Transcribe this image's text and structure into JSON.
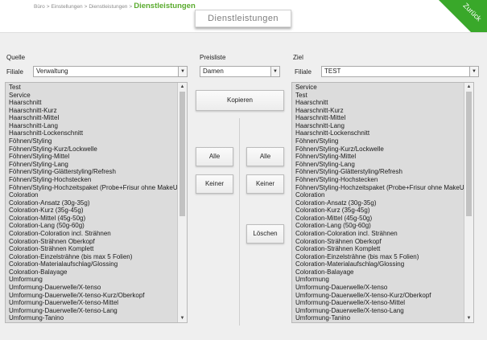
{
  "breadcrumb": {
    "items": [
      "Büro",
      "Einstellungen",
      "Dienstleistungen"
    ],
    "current": "Dienstleistungen",
    "separator": ">"
  },
  "header": {
    "title": "Dienstleistungen",
    "back_label": "Zurück",
    "accent_color": "#39a82a"
  },
  "source": {
    "section_label": "Quelle",
    "branch_label": "Filiale",
    "branch_value": "Verwaltung",
    "items": [
      "Test",
      "Service",
      "Haarschnitt",
      "Haarschnitt-Kurz",
      "Haarschnitt-Mittel",
      "Haarschnitt-Lang",
      "Haarschnitt-Lockenschnitt",
      "Föhnen/Styling",
      "Föhnen/Styling-Kurz/Lockwelle",
      "Föhnen/Styling-Mittel",
      "Föhnen/Styling-Lang",
      "Föhnen/Styling-Glätterstyling/Refresh",
      "Föhnen/Styling-Hochstecken",
      "Föhnen/Styling-Hochzeitspaket (Probe+Frisur ohne MakeUp)",
      "Coloration",
      "Coloration-Ansatz (30g-35g)",
      "Coloration-Kurz (35g-45g)",
      "Coloration-Mittel (45g-50g)",
      "Coloration-Lang (50g-60g)",
      "Coloration-Coloration incl. Strähnen",
      "Coloration-Strähnen Oberkopf",
      "Coloration-Strähnen Komplett",
      "Coloration-Einzelsträhne (bis max 5 Folien)",
      "Coloration-Materialaufschlag/Glossing",
      "Coloration-Balayage",
      "Umformung",
      "Umformung-Dauerwelle/X-tenso",
      "Umformung-Dauerwelle/X-tenso-Kurz/Oberkopf",
      "Umformung-Dauerwelle/X-tenso-Mittel",
      "Umformung-Dauerwelle/X-tenso-Lang",
      "Umformung-Tanino"
    ]
  },
  "pricelist": {
    "label": "Preisliste",
    "value": "Damen"
  },
  "actions": {
    "copy": "Kopieren",
    "all_left": "Alle",
    "none_left": "Keiner",
    "all_right": "Alle",
    "none_right": "Keiner",
    "delete": "Löschen"
  },
  "target": {
    "section_label": "Ziel",
    "branch_label": "Filiale",
    "branch_value": "TEST",
    "items": [
      "Service",
      "Test",
      "Haarschnitt",
      "Haarschnitt-Kurz",
      "Haarschnitt-Mittel",
      "Haarschnitt-Lang",
      "Haarschnitt-Lockenschnitt",
      "Föhnen/Styling",
      "Föhnen/Styling-Kurz/Lockwelle",
      "Föhnen/Styling-Mittel",
      "Föhnen/Styling-Lang",
      "Föhnen/Styling-Glätterstyling/Refresh",
      "Föhnen/Styling-Hochstecken",
      "Föhnen/Styling-Hochzeitspaket (Probe+Frisur ohne MakeUp)",
      "Coloration",
      "Coloration-Ansatz (30g-35g)",
      "Coloration-Kurz (35g-45g)",
      "Coloration-Mittel (45g-50g)",
      "Coloration-Lang (50g-60g)",
      "Coloration-Coloration incl. Strähnen",
      "Coloration-Strähnen Oberkopf",
      "Coloration-Strähnen Komplett",
      "Coloration-Einzelsträhne (bis max 5 Folien)",
      "Coloration-Materialaufschlag/Glossing",
      "Coloration-Balayage",
      "Umformung",
      "Umformung-Dauerwelle/X-tenso",
      "Umformung-Dauerwelle/X-tenso-Kurz/Oberkopf",
      "Umformung-Dauerwelle/X-tenso-Mittel",
      "Umformung-Dauerwelle/X-tenso-Lang",
      "Umformung-Tanino"
    ]
  }
}
